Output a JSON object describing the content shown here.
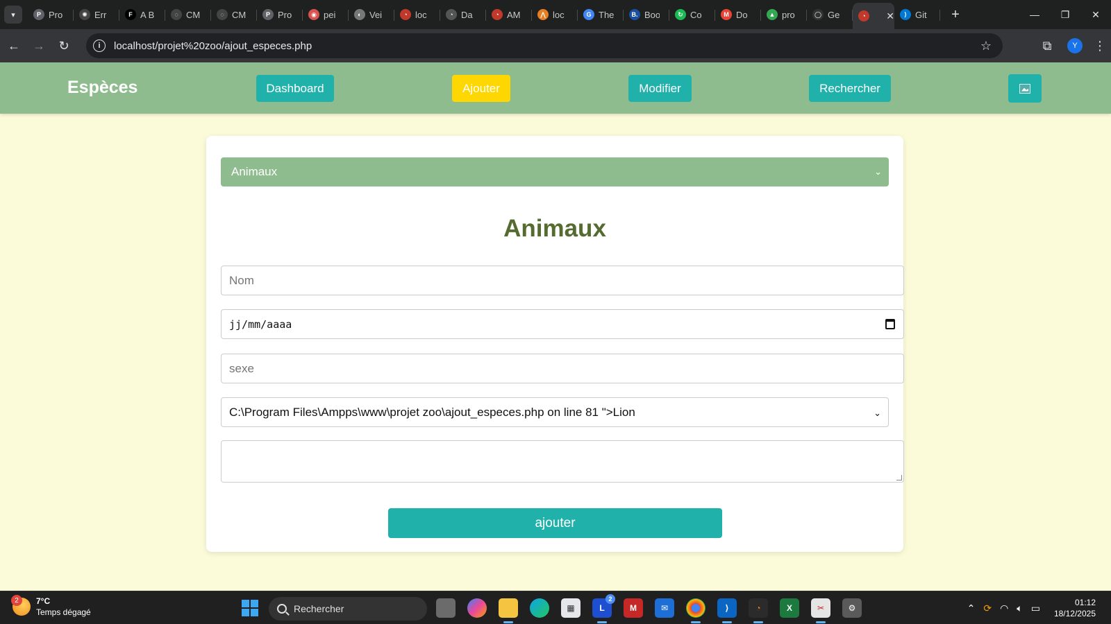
{
  "browser": {
    "tabs": [
      {
        "title": "Pro",
        "fav": "P",
        "color": "#5f6368"
      },
      {
        "title": "Err",
        "fav": "✺",
        "color": "#444"
      },
      {
        "title": "A B",
        "fav": "F",
        "color": "#000"
      },
      {
        "title": "CM",
        "fav": "◌",
        "color": "#444"
      },
      {
        "title": "CM",
        "fav": "◌",
        "color": "#444"
      },
      {
        "title": "Pro",
        "fav": "P",
        "color": "#5f6368"
      },
      {
        "title": "pei",
        "fav": "◉",
        "color": "#d9534f"
      },
      {
        "title": "Vei",
        "fav": "◐",
        "color": "#777"
      },
      {
        "title": "loc",
        "fav": "◔",
        "color": "#c0392b"
      },
      {
        "title": "Da",
        "fav": "◔",
        "color": "#555"
      },
      {
        "title": "AM",
        "fav": "◔",
        "color": "#c0392b"
      },
      {
        "title": "loc",
        "fav": "⋀",
        "color": "#e67e22"
      },
      {
        "title": "The",
        "fav": "G",
        "color": "#4285f4"
      },
      {
        "title": "Boo",
        "fav": "B.",
        "color": "#1a4fa0"
      },
      {
        "title": "Co",
        "fav": "↻",
        "color": "#1db954"
      },
      {
        "title": "Do",
        "fav": "M",
        "color": "#ea4335"
      },
      {
        "title": "pro",
        "fav": "▲",
        "color": "#34a853"
      },
      {
        "title": "Ge",
        "fav": "◯",
        "color": "#333"
      },
      {
        "title": "",
        "fav": "◔",
        "color": "#c0392b",
        "active": true
      },
      {
        "title": "Git",
        "fav": "⟩",
        "color": "#0078d4"
      }
    ],
    "close_tab": "✕",
    "new_tab": "+",
    "url": "localhost/projet%20zoo/ajout_especes.php",
    "avatar_letter": "Y"
  },
  "header": {
    "brand": "Espèces",
    "nav": {
      "dashboard": "Dashboard",
      "ajouter": "Ajouter",
      "modifier": "Modifier",
      "rechercher": "Rechercher"
    }
  },
  "form": {
    "species_select": "Animaux",
    "title": "Animaux",
    "nom_placeholder": "Nom",
    "date_placeholder": "jj/mm/aaaa",
    "sexe_placeholder": "sexe",
    "enclos_select": "C:\\Program Files\\Ampps\\www\\projet zoo\\ajout_especes.php on line 81 \">Lion",
    "submit": "ajouter"
  },
  "taskbar": {
    "weather_badge": "2",
    "temperature": "7°C",
    "weather_text": "Temps dégagé",
    "search_placeholder": "Rechercher",
    "mail_badge": "2",
    "time": "01:12",
    "date": "18/12/2025"
  },
  "colors": {
    "header_bg": "#8fbc8f",
    "button": "#20b2aa",
    "active_button": "#ffd700",
    "title": "#556b2f",
    "page_bg": "#fbfbd9"
  }
}
